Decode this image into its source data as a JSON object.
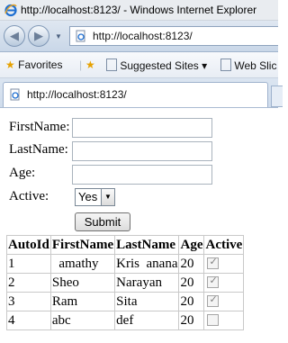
{
  "window": {
    "title": "http://localhost:8123/ - Windows Internet Explorer"
  },
  "address_bar": {
    "url": "http://localhost:8123/"
  },
  "favorites_bar": {
    "favorites_label": "Favorites",
    "items": [
      "Suggested Sites ▾",
      "Web Slic"
    ]
  },
  "tab": {
    "label": "http://localhost:8123/"
  },
  "form": {
    "firstname_label": "FirstName:",
    "lastname_label": "LastName:",
    "age_label": "Age:",
    "active_label": "Active:",
    "active_value": "Yes",
    "submit_label": "Submit"
  },
  "table": {
    "headers": [
      "AutoId",
      "FirstName",
      "LastName",
      "Age",
      "Active"
    ],
    "rows": [
      {
        "autoid": "1",
        "firstname": "  amathy",
        "lastname": "Kris  anana",
        "age": "20",
        "active": true
      },
      {
        "autoid": "2",
        "firstname": "Sheo",
        "lastname": "Narayan",
        "age": "20",
        "active": true
      },
      {
        "autoid": "3",
        "firstname": "Ram",
        "lastname": "Sita",
        "age": "20",
        "active": true
      },
      {
        "autoid": "4",
        "firstname": "abc",
        "lastname": "def",
        "age": "20",
        "active": false
      }
    ]
  },
  "colors": {
    "titlebar_bg": "#e9ecf0",
    "nav_bg": "#c9d7e8",
    "ie_blue": "#1f6fd1"
  },
  "icons": [
    "ie-icon",
    "back-icon",
    "forward-icon",
    "page-icon",
    "favorites-star-icon",
    "add-favorite-icon",
    "dropdown-arrow-icon"
  ]
}
